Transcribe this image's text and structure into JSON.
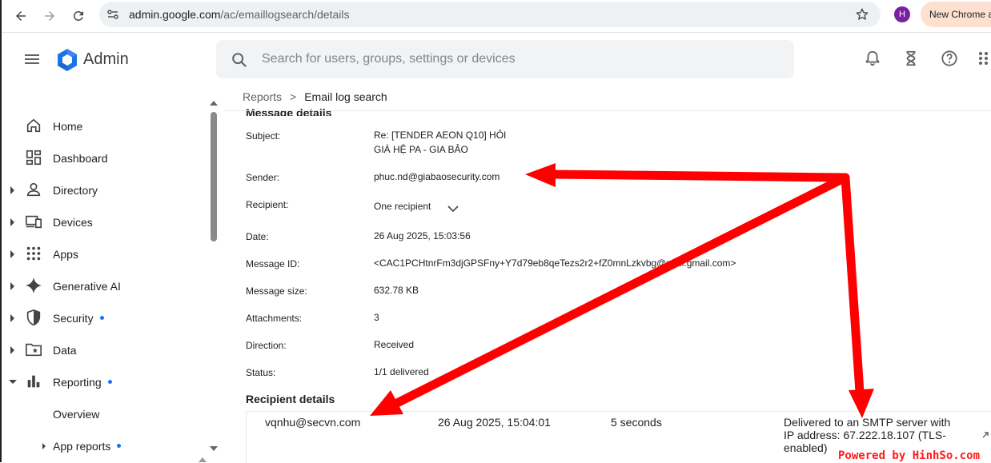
{
  "browser": {
    "url_host": "admin.google.com",
    "url_path": "/ac/emaillogsearch/details",
    "profile_initial": "H",
    "new_chrome_label": "New Chrome a"
  },
  "header": {
    "brand": "Admin",
    "search_placeholder": "Search for users, groups, settings or devices"
  },
  "sidebar": {
    "items": [
      {
        "label": "Home",
        "icon": "home-icon"
      },
      {
        "label": "Dashboard",
        "icon": "dashboard-icon"
      },
      {
        "label": "Directory",
        "icon": "person-icon"
      },
      {
        "label": "Devices",
        "icon": "devices-icon"
      },
      {
        "label": "Apps",
        "icon": "apps-grid-icon"
      },
      {
        "label": "Generative AI",
        "icon": "sparkle-icon"
      },
      {
        "label": "Security",
        "icon": "shield-icon"
      },
      {
        "label": "Data",
        "icon": "folder-star-icon"
      },
      {
        "label": "Reporting",
        "icon": "bar-chart-icon"
      },
      {
        "label": "Overview"
      },
      {
        "label": "App reports"
      }
    ]
  },
  "breadcrumb": {
    "parent": "Reports",
    "separator": ">",
    "current": "Email log search"
  },
  "message_details": {
    "section_title": "Message details",
    "subject_label": "Subject:",
    "subject_line1": "Re: [TENDER AEON Q10] HỎI",
    "subject_line2": "GIÁ HỆ PA - GIA BẢO",
    "sender_label": "Sender:",
    "sender_value": "phuc.nd@giabaosecurity.com",
    "recipient_label": "Recipient:",
    "recipient_value": "One recipient",
    "date_label": "Date:",
    "date_value": "26 Aug 2025, 15:03:56",
    "message_id_label": "Message ID:",
    "message_id_value": "<CAC1PCHtnrFm3djGPSFny+Y7d79eb8qeTezs2r2+fZ0mnLzkvbg@mail.gmail.com>",
    "size_label": "Message size:",
    "size_value": "632.78 KB",
    "attachments_label": "Attachments:",
    "attachments_value": "3",
    "direction_label": "Direction:",
    "direction_value": "Received",
    "status_label": "Status:",
    "status_value": "1/1 delivered"
  },
  "recipient_details": {
    "title": "Recipient details",
    "rows": [
      {
        "email": "vqnhu@secvn.com",
        "time": "26 Aug 2025, 15:04:01",
        "delay": "5 seconds",
        "status": "Delivered to an SMTP server with IP address: 67.222.18.107 (TLS-enabled)"
      }
    ]
  },
  "watermark": "Powered by HinhSo.com",
  "colors": {
    "annotation_arrow": "#ff0000",
    "accent": "#1a73e8"
  }
}
